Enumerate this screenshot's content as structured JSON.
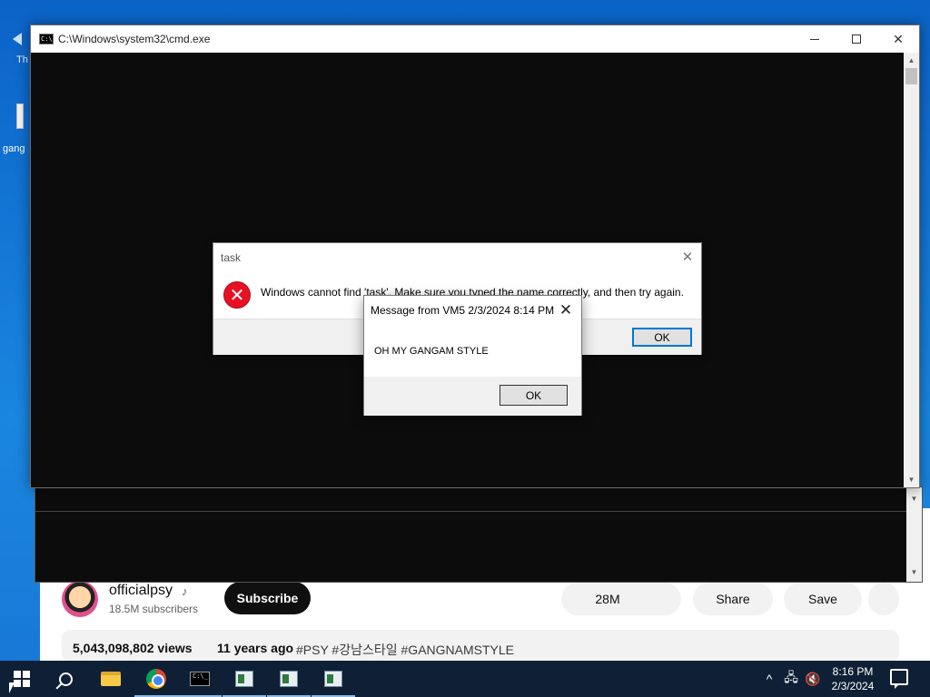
{
  "desktop": {
    "icon_label_partial_1": "Th",
    "icon_label_partial_2": "gang"
  },
  "youtube": {
    "channel_name": "officialpsy",
    "verified_icon": "music-note-icon",
    "subscribers": "18.5M subscribers",
    "subscribe_label": "Subscribe",
    "like_count": "28M",
    "share_label": "Share",
    "save_label": "Save",
    "views": "5,043,098,802 views",
    "age": "11 years ago",
    "tags": "#PSY #강남스타일 #GANGNAMSTYLE"
  },
  "cmd_window": {
    "title": "C:\\Windows\\system32\\cmd.exe",
    "icon_text": "C:\\",
    "minimize_icon": "minimize-icon",
    "maximize_icon": "maximize-icon",
    "close_glyph": "✕"
  },
  "error_dialog": {
    "title": "task",
    "close_glyph": "✕",
    "icon": "error-icon",
    "icon_glyph": "✕",
    "message": "Windows cannot find 'task'. Make sure you typed the name correctly, and then try again.",
    "ok_label": "OK",
    "accent": "#0078d7",
    "icon_color": "#e81123"
  },
  "message_popup": {
    "title": "Message from VM5 2/3/2024 8:14 PM",
    "close_glyph": "✕",
    "text": "OH MY GANGAM STYLE",
    "ok_label": "OK"
  },
  "taskbar": {
    "apps": [
      "start",
      "search",
      "file-explorer",
      "chrome",
      "cmd",
      "app-1",
      "app-2",
      "app-3"
    ],
    "clock_time": "8:16 PM",
    "clock_date": "2/3/2024",
    "tray_chevron": "^",
    "background": "#0f2036"
  }
}
